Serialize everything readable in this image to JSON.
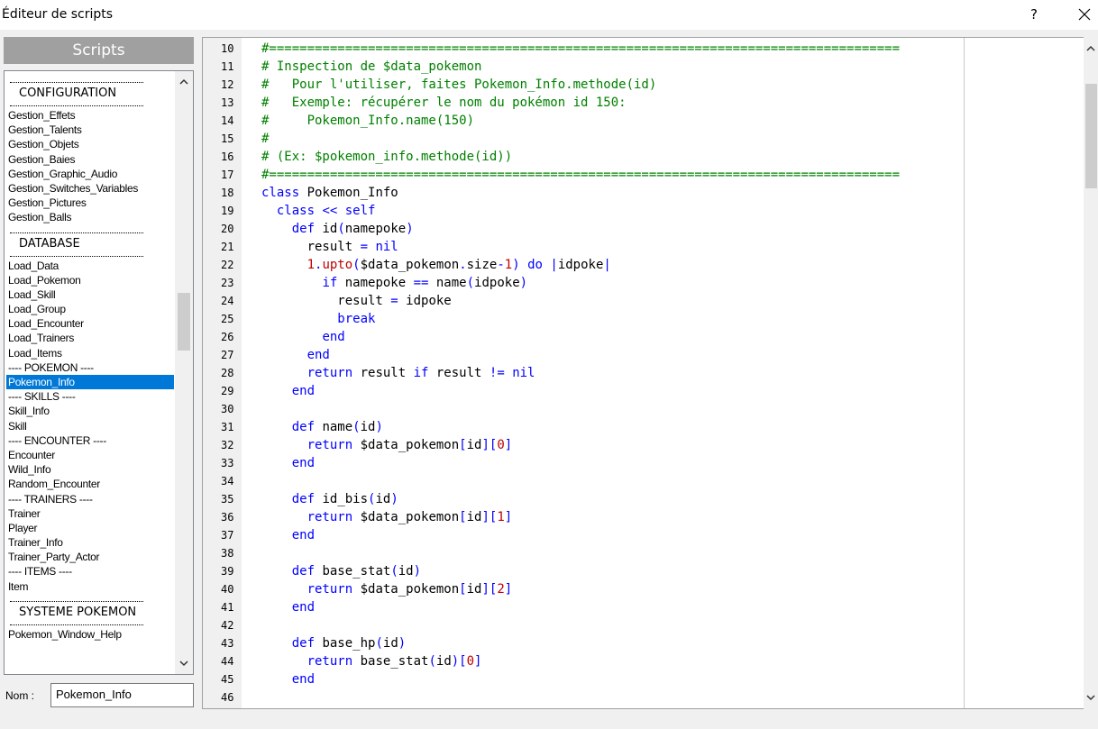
{
  "window": {
    "title": "Éditeur de scripts",
    "help_label": "?",
    "close_icon": "close-icon"
  },
  "sidebar": {
    "header": "Scripts",
    "items": [
      {
        "type": "section",
        "label": "CONFIGURATION"
      },
      {
        "type": "item",
        "label": "Gestion_Effets"
      },
      {
        "type": "item",
        "label": "Gestion_Talents"
      },
      {
        "type": "item",
        "label": "Gestion_Objets"
      },
      {
        "type": "item",
        "label": "Gestion_Baies"
      },
      {
        "type": "item",
        "label": "Gestion_Graphic_Audio"
      },
      {
        "type": "item",
        "label": "Gestion_Switches_Variables"
      },
      {
        "type": "item",
        "label": "Gestion_Pictures"
      },
      {
        "type": "item",
        "label": "Gestion_Balls"
      },
      {
        "type": "section",
        "label": "DATABASE"
      },
      {
        "type": "item",
        "label": "Load_Data"
      },
      {
        "type": "item",
        "label": "Load_Pokemon"
      },
      {
        "type": "item",
        "label": "Load_Skill"
      },
      {
        "type": "item",
        "label": "Load_Group"
      },
      {
        "type": "item",
        "label": "Load_Encounter"
      },
      {
        "type": "item",
        "label": "Load_Trainers"
      },
      {
        "type": "item",
        "label": "Load_Items"
      },
      {
        "type": "item",
        "label": "---- POKEMON ----"
      },
      {
        "type": "item",
        "label": "Pokemon_Info",
        "selected": true
      },
      {
        "type": "item",
        "label": "---- SKILLS ----"
      },
      {
        "type": "item",
        "label": "Skill_Info"
      },
      {
        "type": "item",
        "label": "Skill"
      },
      {
        "type": "item",
        "label": "---- ENCOUNTER ----"
      },
      {
        "type": "item",
        "label": "Encounter"
      },
      {
        "type": "item",
        "label": "Wild_Info"
      },
      {
        "type": "item",
        "label": "Random_Encounter"
      },
      {
        "type": "item",
        "label": "---- TRAINERS ----"
      },
      {
        "type": "item",
        "label": "Trainer"
      },
      {
        "type": "item",
        "label": "Player"
      },
      {
        "type": "item",
        "label": "Trainer_Info"
      },
      {
        "type": "item",
        "label": "Trainer_Party_Actor"
      },
      {
        "type": "item",
        "label": "---- ITEMS ----"
      },
      {
        "type": "item",
        "label": "Item"
      },
      {
        "type": "section",
        "label": "SYSTEME POKEMON"
      },
      {
        "type": "item",
        "label": "Pokemon_Window_Help"
      }
    ]
  },
  "name_field": {
    "label": "Nom :",
    "value": "Pokemon_Info"
  },
  "editor": {
    "lines": [
      {
        "n": "10",
        "tokens": [
          [
            "cm",
            "#==================================================================================="
          ]
        ]
      },
      {
        "n": "11",
        "tokens": [
          [
            "cm",
            "# Inspection de $data_pokemon"
          ]
        ]
      },
      {
        "n": "12",
        "tokens": [
          [
            "cm",
            "#   Pour l'utiliser, faites Pokemon_Info.methode(id)"
          ]
        ]
      },
      {
        "n": "13",
        "tokens": [
          [
            "cm",
            "#   Exemple: récupérer le nom du pokémon id 150:"
          ]
        ]
      },
      {
        "n": "14",
        "tokens": [
          [
            "cm",
            "#     Pokemon_Info.name(150)"
          ]
        ]
      },
      {
        "n": "15",
        "tokens": [
          [
            "cm",
            "#"
          ]
        ]
      },
      {
        "n": "16",
        "tokens": [
          [
            "cm",
            "# (Ex: $pokemon_info.methode(id))"
          ]
        ]
      },
      {
        "n": "17",
        "tokens": [
          [
            "cm",
            "#==================================================================================="
          ]
        ]
      },
      {
        "n": "18",
        "tokens": [
          [
            "kw",
            "class"
          ],
          [
            "pl",
            " Pokemon_Info"
          ]
        ]
      },
      {
        "n": "19",
        "tokens": [
          [
            "pl",
            "  "
          ],
          [
            "kw",
            "class"
          ],
          [
            "pl",
            " "
          ],
          [
            "op",
            "<<"
          ],
          [
            "pl",
            " "
          ],
          [
            "kw",
            "self"
          ]
        ]
      },
      {
        "n": "20",
        "tokens": [
          [
            "pl",
            "    "
          ],
          [
            "kw",
            "def"
          ],
          [
            "pl",
            " id"
          ],
          [
            "op",
            "("
          ],
          [
            "pl",
            "namepoke"
          ],
          [
            "op",
            ")"
          ]
        ]
      },
      {
        "n": "21",
        "tokens": [
          [
            "pl",
            "      result "
          ],
          [
            "op",
            "="
          ],
          [
            "pl",
            " "
          ],
          [
            "kw",
            "nil"
          ]
        ]
      },
      {
        "n": "22",
        "tokens": [
          [
            "pl",
            "      "
          ],
          [
            "num",
            "1"
          ],
          [
            "op",
            "."
          ],
          [
            "num",
            "upto"
          ],
          [
            "op",
            "("
          ],
          [
            "pl",
            "$data_pokemon"
          ],
          [
            "op",
            "."
          ],
          [
            "pl",
            "size"
          ],
          [
            "op",
            "-"
          ],
          [
            "num",
            "1"
          ],
          [
            "op",
            ")"
          ],
          [
            "pl",
            " "
          ],
          [
            "kw",
            "do"
          ],
          [
            "pl",
            " "
          ],
          [
            "op",
            "|"
          ],
          [
            "pl",
            "idpoke"
          ],
          [
            "op",
            "|"
          ]
        ]
      },
      {
        "n": "23",
        "tokens": [
          [
            "pl",
            "        "
          ],
          [
            "kw",
            "if"
          ],
          [
            "pl",
            " namepoke "
          ],
          [
            "op",
            "=="
          ],
          [
            "pl",
            " name"
          ],
          [
            "op",
            "("
          ],
          [
            "pl",
            "idpoke"
          ],
          [
            "op",
            ")"
          ]
        ]
      },
      {
        "n": "24",
        "tokens": [
          [
            "pl",
            "          result "
          ],
          [
            "op",
            "="
          ],
          [
            "pl",
            " idpoke"
          ]
        ]
      },
      {
        "n": "25",
        "tokens": [
          [
            "pl",
            "          "
          ],
          [
            "kw",
            "break"
          ]
        ]
      },
      {
        "n": "26",
        "tokens": [
          [
            "pl",
            "        "
          ],
          [
            "kw",
            "end"
          ]
        ]
      },
      {
        "n": "27",
        "tokens": [
          [
            "pl",
            "      "
          ],
          [
            "kw",
            "end"
          ]
        ]
      },
      {
        "n": "28",
        "tokens": [
          [
            "pl",
            "      "
          ],
          [
            "kw",
            "return"
          ],
          [
            "pl",
            " result "
          ],
          [
            "kw",
            "if"
          ],
          [
            "pl",
            " result "
          ],
          [
            "op",
            "!="
          ],
          [
            "pl",
            " "
          ],
          [
            "kw",
            "nil"
          ]
        ]
      },
      {
        "n": "29",
        "tokens": [
          [
            "pl",
            "    "
          ],
          [
            "kw",
            "end"
          ]
        ]
      },
      {
        "n": "30",
        "tokens": []
      },
      {
        "n": "31",
        "tokens": [
          [
            "pl",
            "    "
          ],
          [
            "kw",
            "def"
          ],
          [
            "pl",
            " name"
          ],
          [
            "op",
            "("
          ],
          [
            "pl",
            "id"
          ],
          [
            "op",
            ")"
          ]
        ]
      },
      {
        "n": "32",
        "tokens": [
          [
            "pl",
            "      "
          ],
          [
            "kw",
            "return"
          ],
          [
            "pl",
            " $data_pokemon"
          ],
          [
            "op",
            "["
          ],
          [
            "pl",
            "id"
          ],
          [
            "op",
            "]["
          ],
          [
            "num",
            "0"
          ],
          [
            "op",
            "]"
          ]
        ]
      },
      {
        "n": "33",
        "tokens": [
          [
            "pl",
            "    "
          ],
          [
            "kw",
            "end"
          ]
        ]
      },
      {
        "n": "34",
        "tokens": []
      },
      {
        "n": "35",
        "tokens": [
          [
            "pl",
            "    "
          ],
          [
            "kw",
            "def"
          ],
          [
            "pl",
            " id_bis"
          ],
          [
            "op",
            "("
          ],
          [
            "pl",
            "id"
          ],
          [
            "op",
            ")"
          ]
        ]
      },
      {
        "n": "36",
        "tokens": [
          [
            "pl",
            "      "
          ],
          [
            "kw",
            "return"
          ],
          [
            "pl",
            " $data_pokemon"
          ],
          [
            "op",
            "["
          ],
          [
            "pl",
            "id"
          ],
          [
            "op",
            "]["
          ],
          [
            "num",
            "1"
          ],
          [
            "op",
            "]"
          ]
        ]
      },
      {
        "n": "37",
        "tokens": [
          [
            "pl",
            "    "
          ],
          [
            "kw",
            "end"
          ]
        ]
      },
      {
        "n": "38",
        "tokens": []
      },
      {
        "n": "39",
        "tokens": [
          [
            "pl",
            "    "
          ],
          [
            "kw",
            "def"
          ],
          [
            "pl",
            " base_stat"
          ],
          [
            "op",
            "("
          ],
          [
            "pl",
            "id"
          ],
          [
            "op",
            ")"
          ]
        ]
      },
      {
        "n": "40",
        "tokens": [
          [
            "pl",
            "      "
          ],
          [
            "kw",
            "return"
          ],
          [
            "pl",
            " $data_pokemon"
          ],
          [
            "op",
            "["
          ],
          [
            "pl",
            "id"
          ],
          [
            "op",
            "]["
          ],
          [
            "num",
            "2"
          ],
          [
            "op",
            "]"
          ]
        ]
      },
      {
        "n": "41",
        "tokens": [
          [
            "pl",
            "    "
          ],
          [
            "kw",
            "end"
          ]
        ]
      },
      {
        "n": "42",
        "tokens": []
      },
      {
        "n": "43",
        "tokens": [
          [
            "pl",
            "    "
          ],
          [
            "kw",
            "def"
          ],
          [
            "pl",
            " base_hp"
          ],
          [
            "op",
            "("
          ],
          [
            "pl",
            "id"
          ],
          [
            "op",
            ")"
          ]
        ]
      },
      {
        "n": "44",
        "tokens": [
          [
            "pl",
            "      "
          ],
          [
            "kw",
            "return"
          ],
          [
            "pl",
            " base_stat"
          ],
          [
            "op",
            "("
          ],
          [
            "pl",
            "id"
          ],
          [
            "op",
            ")["
          ],
          [
            "num",
            "0"
          ],
          [
            "op",
            "]"
          ]
        ]
      },
      {
        "n": "45",
        "tokens": [
          [
            "pl",
            "    "
          ],
          [
            "kw",
            "end"
          ]
        ]
      },
      {
        "n": "46",
        "tokens": []
      }
    ]
  },
  "colors": {
    "comment": "#008000",
    "keyword": "#0000ff",
    "number": "#c00000",
    "selection": "#0078d7"
  }
}
